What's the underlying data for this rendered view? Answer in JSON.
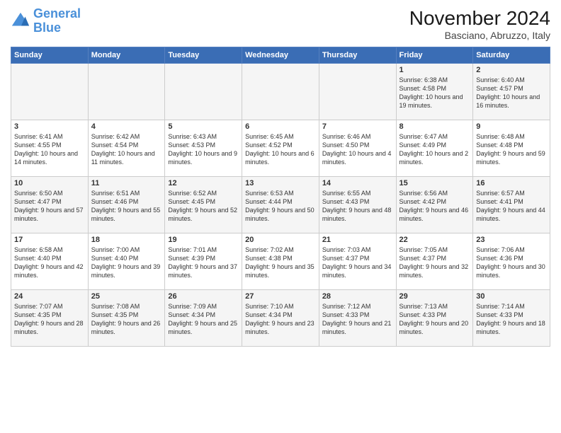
{
  "logo": {
    "line1": "General",
    "line2": "Blue"
  },
  "title": "November 2024",
  "location": "Basciano, Abruzzo, Italy",
  "weekdays": [
    "Sunday",
    "Monday",
    "Tuesday",
    "Wednesday",
    "Thursday",
    "Friday",
    "Saturday"
  ],
  "weeks": [
    [
      {
        "day": "",
        "info": ""
      },
      {
        "day": "",
        "info": ""
      },
      {
        "day": "",
        "info": ""
      },
      {
        "day": "",
        "info": ""
      },
      {
        "day": "",
        "info": ""
      },
      {
        "day": "1",
        "info": "Sunrise: 6:38 AM\nSunset: 4:58 PM\nDaylight: 10 hours and 19 minutes."
      },
      {
        "day": "2",
        "info": "Sunrise: 6:40 AM\nSunset: 4:57 PM\nDaylight: 10 hours and 16 minutes."
      }
    ],
    [
      {
        "day": "3",
        "info": "Sunrise: 6:41 AM\nSunset: 4:55 PM\nDaylight: 10 hours and 14 minutes."
      },
      {
        "day": "4",
        "info": "Sunrise: 6:42 AM\nSunset: 4:54 PM\nDaylight: 10 hours and 11 minutes."
      },
      {
        "day": "5",
        "info": "Sunrise: 6:43 AM\nSunset: 4:53 PM\nDaylight: 10 hours and 9 minutes."
      },
      {
        "day": "6",
        "info": "Sunrise: 6:45 AM\nSunset: 4:52 PM\nDaylight: 10 hours and 6 minutes."
      },
      {
        "day": "7",
        "info": "Sunrise: 6:46 AM\nSunset: 4:50 PM\nDaylight: 10 hours and 4 minutes."
      },
      {
        "day": "8",
        "info": "Sunrise: 6:47 AM\nSunset: 4:49 PM\nDaylight: 10 hours and 2 minutes."
      },
      {
        "day": "9",
        "info": "Sunrise: 6:48 AM\nSunset: 4:48 PM\nDaylight: 9 hours and 59 minutes."
      }
    ],
    [
      {
        "day": "10",
        "info": "Sunrise: 6:50 AM\nSunset: 4:47 PM\nDaylight: 9 hours and 57 minutes."
      },
      {
        "day": "11",
        "info": "Sunrise: 6:51 AM\nSunset: 4:46 PM\nDaylight: 9 hours and 55 minutes."
      },
      {
        "day": "12",
        "info": "Sunrise: 6:52 AM\nSunset: 4:45 PM\nDaylight: 9 hours and 52 minutes."
      },
      {
        "day": "13",
        "info": "Sunrise: 6:53 AM\nSunset: 4:44 PM\nDaylight: 9 hours and 50 minutes."
      },
      {
        "day": "14",
        "info": "Sunrise: 6:55 AM\nSunset: 4:43 PM\nDaylight: 9 hours and 48 minutes."
      },
      {
        "day": "15",
        "info": "Sunrise: 6:56 AM\nSunset: 4:42 PM\nDaylight: 9 hours and 46 minutes."
      },
      {
        "day": "16",
        "info": "Sunrise: 6:57 AM\nSunset: 4:41 PM\nDaylight: 9 hours and 44 minutes."
      }
    ],
    [
      {
        "day": "17",
        "info": "Sunrise: 6:58 AM\nSunset: 4:40 PM\nDaylight: 9 hours and 42 minutes."
      },
      {
        "day": "18",
        "info": "Sunrise: 7:00 AM\nSunset: 4:40 PM\nDaylight: 9 hours and 39 minutes."
      },
      {
        "day": "19",
        "info": "Sunrise: 7:01 AM\nSunset: 4:39 PM\nDaylight: 9 hours and 37 minutes."
      },
      {
        "day": "20",
        "info": "Sunrise: 7:02 AM\nSunset: 4:38 PM\nDaylight: 9 hours and 35 minutes."
      },
      {
        "day": "21",
        "info": "Sunrise: 7:03 AM\nSunset: 4:37 PM\nDaylight: 9 hours and 34 minutes."
      },
      {
        "day": "22",
        "info": "Sunrise: 7:05 AM\nSunset: 4:37 PM\nDaylight: 9 hours and 32 minutes."
      },
      {
        "day": "23",
        "info": "Sunrise: 7:06 AM\nSunset: 4:36 PM\nDaylight: 9 hours and 30 minutes."
      }
    ],
    [
      {
        "day": "24",
        "info": "Sunrise: 7:07 AM\nSunset: 4:35 PM\nDaylight: 9 hours and 28 minutes."
      },
      {
        "day": "25",
        "info": "Sunrise: 7:08 AM\nSunset: 4:35 PM\nDaylight: 9 hours and 26 minutes."
      },
      {
        "day": "26",
        "info": "Sunrise: 7:09 AM\nSunset: 4:34 PM\nDaylight: 9 hours and 25 minutes."
      },
      {
        "day": "27",
        "info": "Sunrise: 7:10 AM\nSunset: 4:34 PM\nDaylight: 9 hours and 23 minutes."
      },
      {
        "day": "28",
        "info": "Sunrise: 7:12 AM\nSunset: 4:33 PM\nDaylight: 9 hours and 21 minutes."
      },
      {
        "day": "29",
        "info": "Sunrise: 7:13 AM\nSunset: 4:33 PM\nDaylight: 9 hours and 20 minutes."
      },
      {
        "day": "30",
        "info": "Sunrise: 7:14 AM\nSunset: 4:33 PM\nDaylight: 9 hours and 18 minutes."
      }
    ]
  ]
}
